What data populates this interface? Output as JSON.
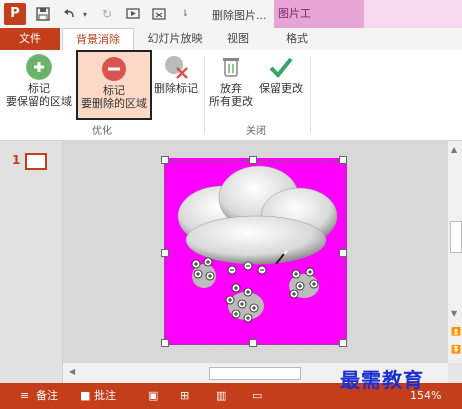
{
  "app": {
    "app_icon_letter": "P",
    "doc_title": "删除图片...",
    "context_tab_title": "图片工"
  },
  "tabs": {
    "file": "文件",
    "background_removal": "背景消除",
    "slideshow": "幻灯片放映",
    "view": "视图",
    "format": "格式"
  },
  "ribbon": {
    "mark_keep": "标记\n要保留的区域",
    "mark_keep_line1": "标记",
    "mark_keep_line2": "要保留的区域",
    "mark_remove_line1": "标记",
    "mark_remove_line2": "要删除的区域",
    "delete_mark": "删除标记",
    "discard_line1": "放弃",
    "discard_line2": "所有更改",
    "keep_changes": "保留更改",
    "group_optimize": "优化",
    "group_close": "关闭"
  },
  "slides_panel": {
    "slide_number": "1"
  },
  "statusbar": {
    "notes": "备注",
    "comments": "批注",
    "zoom": "154%"
  },
  "watermark": "最需教育",
  "colors": {
    "accent": "#c43e1c",
    "removal_magenta": "#ff00ff",
    "context_tab": "#e9a4d6"
  }
}
